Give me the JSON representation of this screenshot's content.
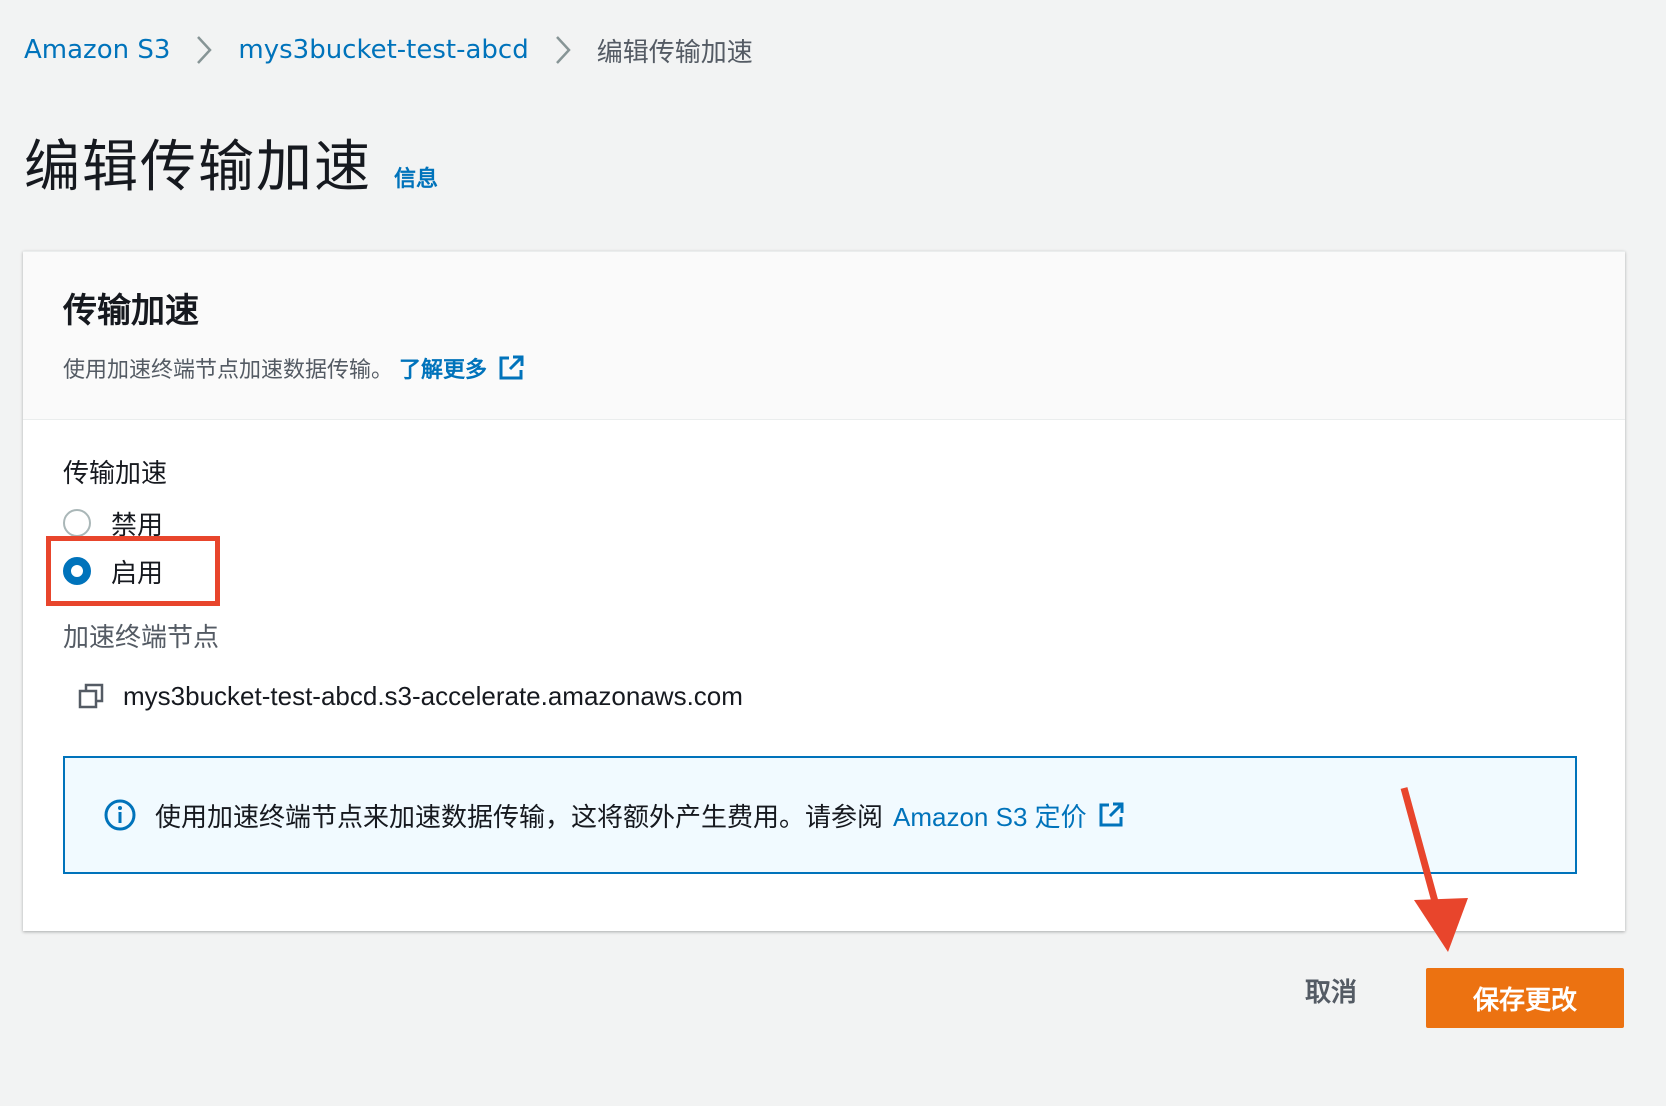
{
  "breadcrumb": {
    "items": [
      "Amazon S3",
      "mys3bucket-test-abcd"
    ],
    "current": "编辑传输加速"
  },
  "page": {
    "title": "编辑传输加速",
    "info_link": "信息"
  },
  "panel": {
    "title": "传输加速",
    "description": "使用加速终端节点加速数据传输。",
    "learn_more": "了解更多"
  },
  "transfer_acceleration": {
    "label": "传输加速",
    "options": [
      {
        "label": "禁用",
        "selected": false
      },
      {
        "label": "启用",
        "selected": true
      }
    ]
  },
  "endpoint": {
    "label": "加速终端节点",
    "value": "mys3bucket-test-abcd.s3-accelerate.amazonaws.com"
  },
  "alert": {
    "text": "使用加速终端节点来加速数据传输，这将额外产生费用。请参阅",
    "link": "Amazon S3 定价"
  },
  "footer": {
    "cancel_label": "取消",
    "save_label": "保存更改"
  },
  "colors": {
    "link": "#0073bb",
    "primary_button": "#ec7211",
    "annotation": "#e8452c",
    "background": "#f2f3f3"
  },
  "icons": [
    "chevron-right-icon",
    "external-link-icon",
    "copy-icon",
    "info-circle-icon"
  ]
}
